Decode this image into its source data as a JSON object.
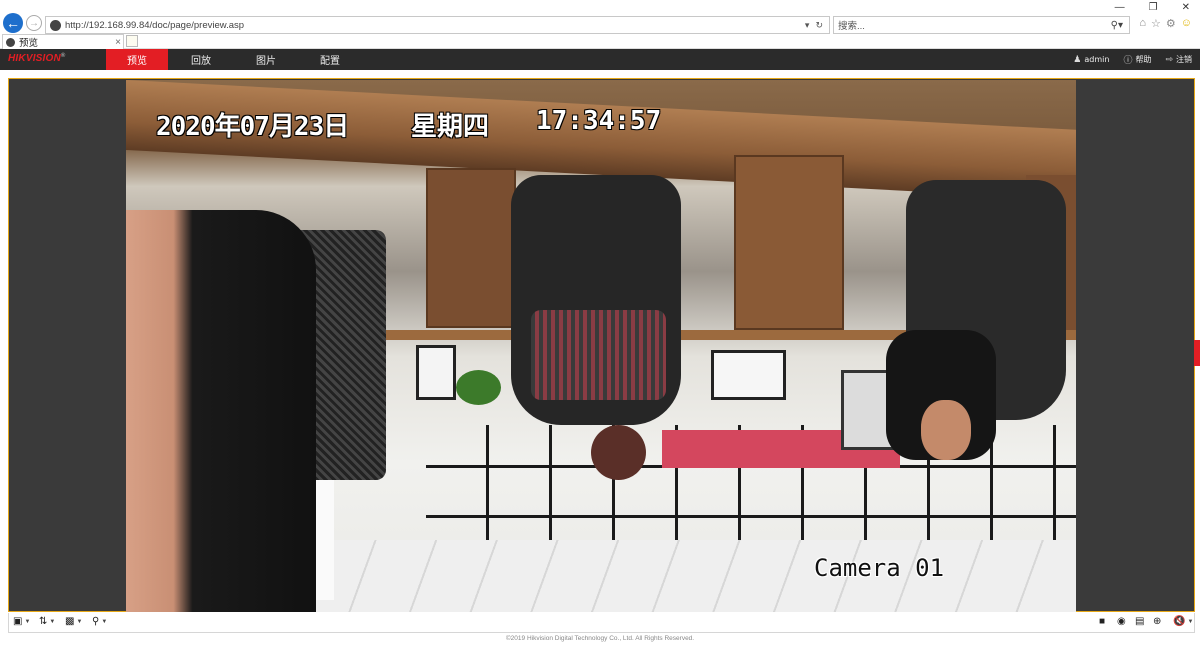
{
  "browser": {
    "url": "http://192.168.99.84/doc/page/preview.asp",
    "search_placeholder": "搜索...",
    "tab_title": "预览",
    "back_icon": "back-arrow-icon",
    "forward_icon": "forward-arrow-icon",
    "refresh_icon": "refresh-icon",
    "search_icon": "search-icon",
    "toolbar_icons": [
      "home-icon",
      "favorites-star-icon",
      "settings-gear-icon",
      "feedback-smiley-icon"
    ]
  },
  "app": {
    "logo": "HIKVISION",
    "nav": {
      "preview": "预览",
      "playback": "回放",
      "picture": "图片",
      "config": "配置",
      "active": "preview"
    },
    "user": {
      "username": "admin",
      "help": "帮助",
      "logout": "注销"
    },
    "accent_color": "#e31e24"
  },
  "video": {
    "osd_date": "2020年07月23日",
    "osd_weekday": "星期四",
    "osd_time": "17:34:57",
    "osd_camera_name": "Camera 01"
  },
  "controls": {
    "left": [
      "window-layout-icon",
      "stream-type-icon",
      "plugin-icon",
      "microphone-icon"
    ],
    "right": [
      "stop-all-icon",
      "capture-all-icon",
      "record-all-icon",
      "digital-zoom-icon",
      "audio-muted-icon"
    ]
  },
  "footer": {
    "copyright": "©2019 Hikvision Digital Technology Co., Ltd. All Rights Reserved."
  }
}
